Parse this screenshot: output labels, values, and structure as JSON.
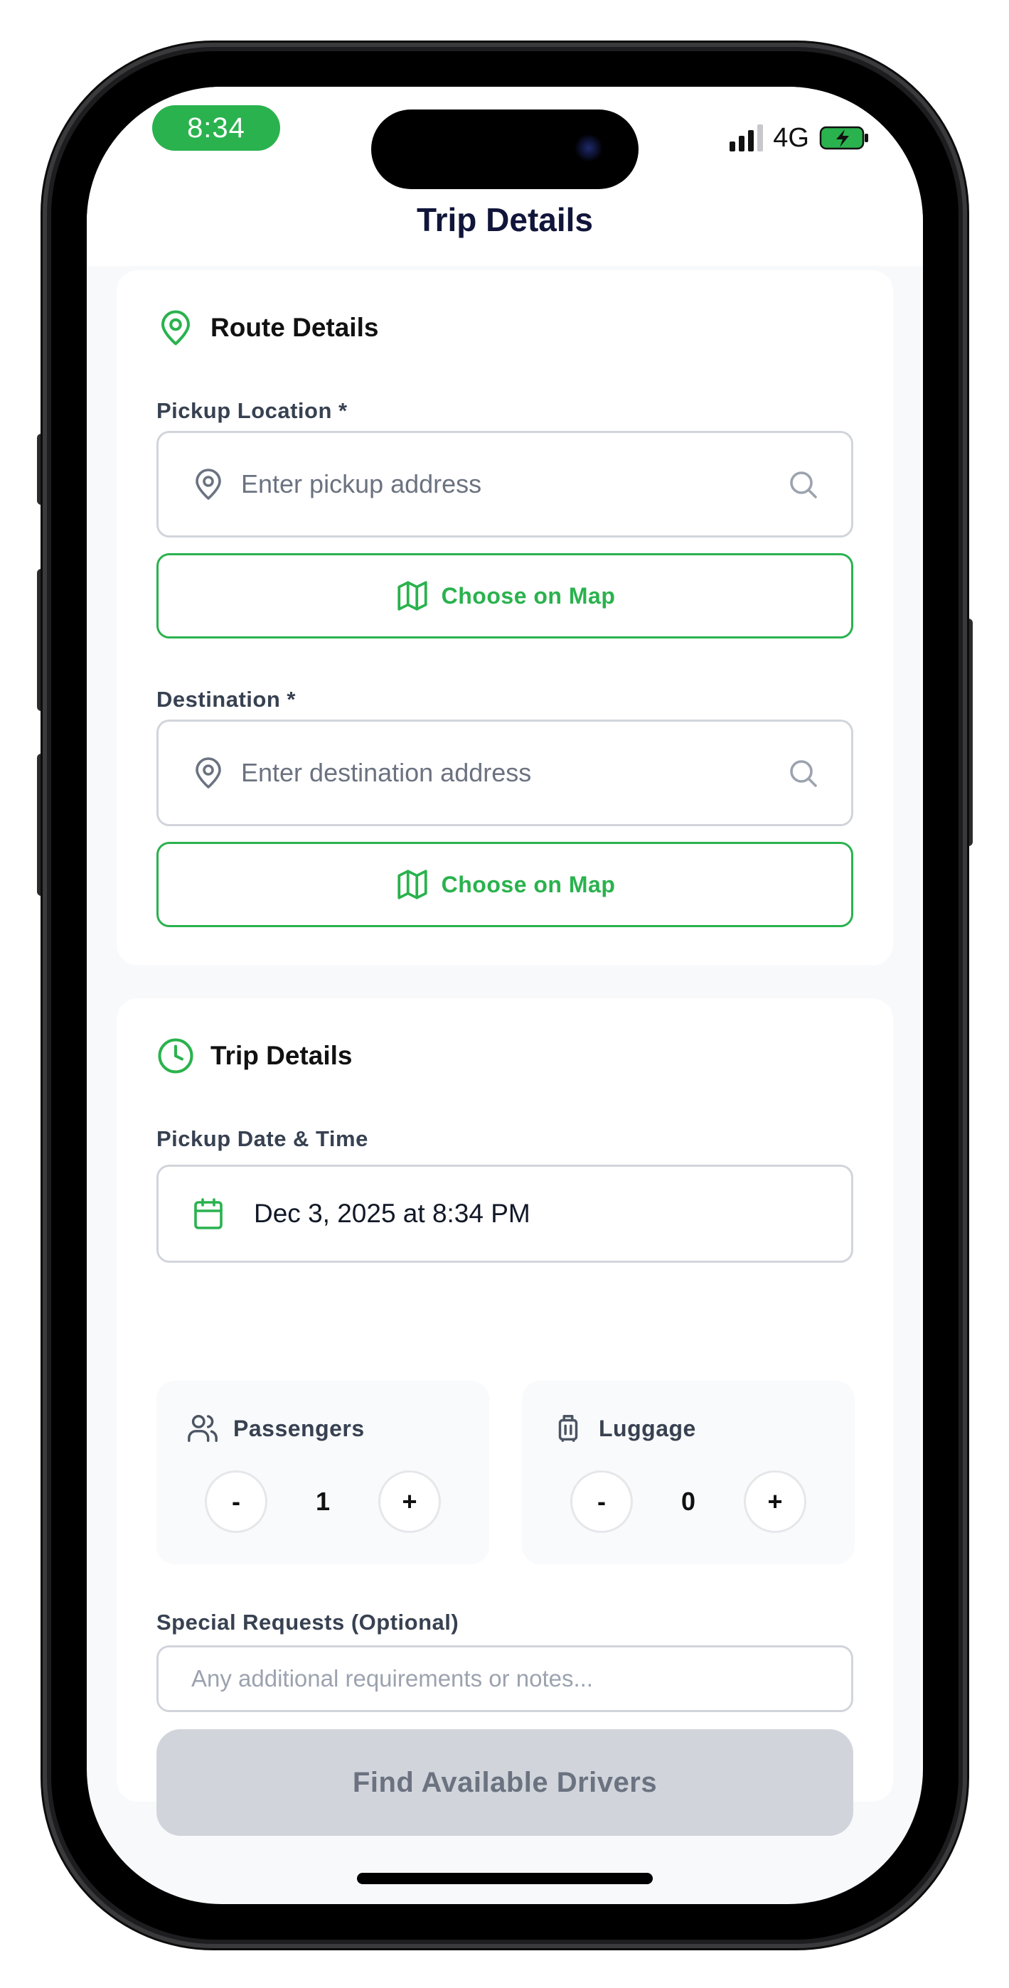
{
  "status_bar": {
    "time": "8:34",
    "network": "4G",
    "time_pill_color": "#2ab24e"
  },
  "header": {
    "title": "Trip Details"
  },
  "route_card": {
    "title": "Route Details",
    "icon": "map-pin-icon",
    "pickup": {
      "label": "Pickup Location *",
      "placeholder": "Enter pickup address",
      "map_button": "Choose on Map"
    },
    "destination": {
      "label": "Destination *",
      "placeholder": "Enter destination address",
      "map_button": "Choose on Map"
    }
  },
  "trip_card": {
    "title": "Trip Details",
    "icon": "clock-icon",
    "datetime": {
      "label": "Pickup Date & Time",
      "value": "Dec 3, 2025 at 8:34 PM"
    },
    "passengers": {
      "label": "Passengers",
      "value": "1",
      "minus": "-",
      "plus": "+"
    },
    "luggage": {
      "label": "Luggage",
      "value": "0",
      "minus": "-",
      "plus": "+"
    },
    "special_requests": {
      "label": "Special Requests (Optional)",
      "placeholder": "Any additional requirements or notes..."
    },
    "submit_button": "Find Available Drivers"
  },
  "colors": {
    "accent": "#2ab24e",
    "title": "#11153a",
    "disabled_button": "#d1d5db"
  }
}
